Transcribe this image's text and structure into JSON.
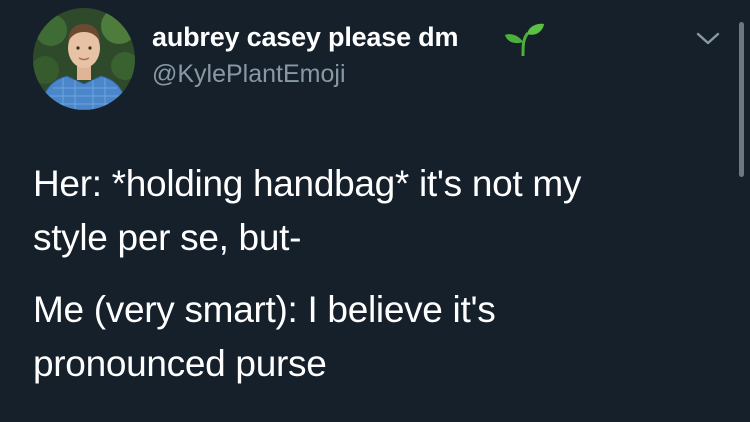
{
  "tweet": {
    "author": {
      "display_name": "aubrey casey please dm",
      "name_emoji": "seedling-icon",
      "handle": "@KylePlantEmoji",
      "avatar": "avatar"
    },
    "menu_icon": "chevron-down-icon",
    "text": {
      "paragraph_1": "Her: *holding handbag* it's not my\nstyle per se, but-",
      "paragraph_2": "Me (very smart): I believe it's\npronounced purse"
    }
  },
  "colors": {
    "background": "#15202b",
    "primary_text": "#ffffff",
    "secondary_text": "#8899a6",
    "sprout_green": "#4caf3a"
  }
}
